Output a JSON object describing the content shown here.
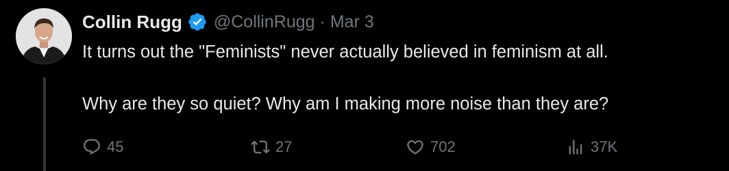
{
  "author": {
    "name": "Collin Rugg",
    "handle": "@CollinRugg",
    "verified": true,
    "avatar_icon": "profile-photo"
  },
  "separator": "·",
  "date": "Mar 3",
  "tweet": {
    "paragraphs": [
      "It turns out the \"Feminists\" never actually believed in feminism at all.",
      "Why are they so quiet? Why am I making more noise than they are?"
    ]
  },
  "actions": {
    "reply": {
      "icon": "reply-icon",
      "count": "45"
    },
    "retweet": {
      "icon": "retweet-icon",
      "count": "27"
    },
    "like": {
      "icon": "heart-icon",
      "count": "702"
    },
    "views": {
      "icon": "views-icon",
      "count": "37K"
    }
  },
  "colors": {
    "background": "#000000",
    "text": "#e7e9ea",
    "muted": "#71767b",
    "verified_blue": "#1d9bf0"
  }
}
